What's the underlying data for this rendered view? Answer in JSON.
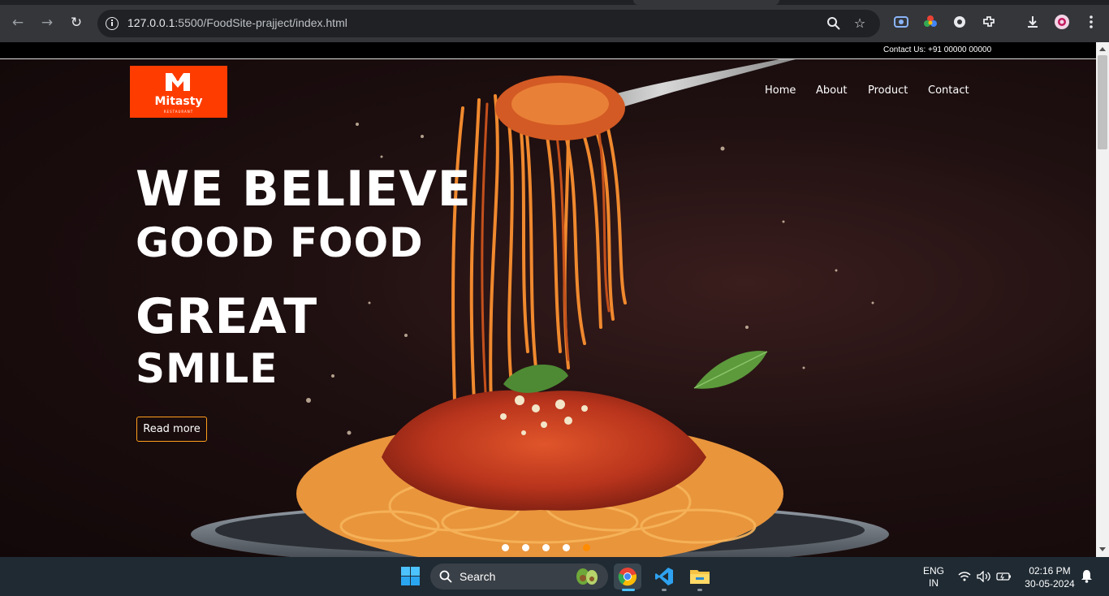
{
  "browser": {
    "url_host": "127.0.0.1",
    "url_path": ":5500/FoodSite-prajject/index.html"
  },
  "site": {
    "contact_line": "Contact Us: +91 00000 00000",
    "logo": {
      "name": "Mitasty",
      "tagline": "RESTAURANT"
    },
    "nav": [
      "Home",
      "About",
      "Product",
      "Contact"
    ],
    "hero": {
      "line1": "WE BELIEVE",
      "line2": "GOOD FOOD",
      "line3": "GREAT",
      "line4": "SMILE",
      "cta": "Read more"
    },
    "slider": {
      "slides": 5,
      "active": 5
    },
    "colors": {
      "logo_bg": "#ff3c00",
      "cta_border": "#ff9f1c",
      "dot_active": "#ff8c00"
    }
  },
  "taskbar": {
    "search_label": "Search",
    "lang": "ENG",
    "region": "IN",
    "time": "02:16 PM",
    "date": "30-05-2024"
  }
}
